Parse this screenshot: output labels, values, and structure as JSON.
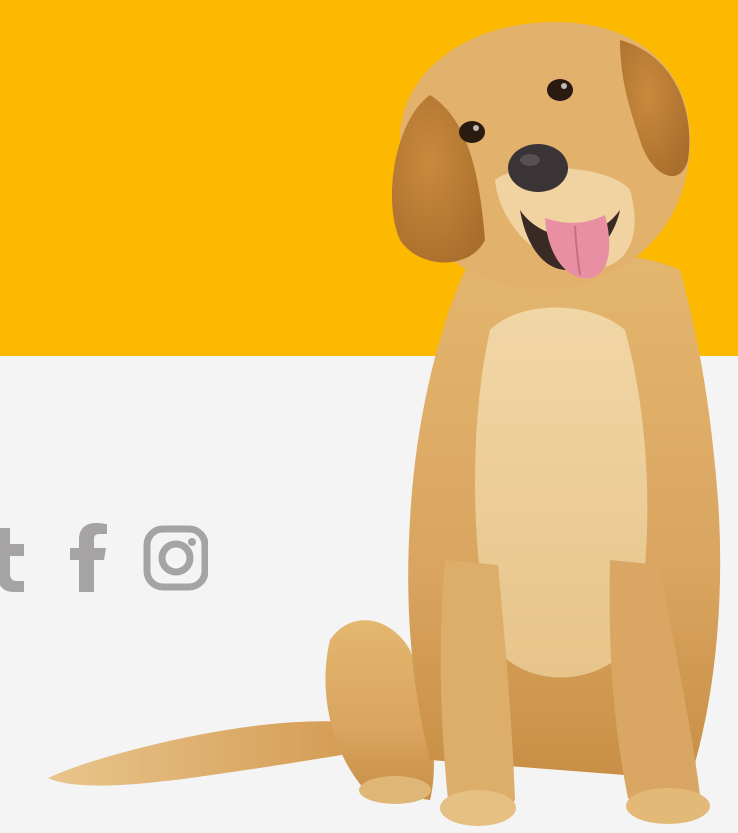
{
  "page": {
    "colors": {
      "accent_yellow": "#FDB800",
      "background_light": "#F4F4F5",
      "icon_gray": "#A5A3A4",
      "dog_gold": "#D9A560"
    }
  },
  "social": {
    "links": [
      {
        "network": "tumblr",
        "icon": "tumblr-icon"
      },
      {
        "network": "facebook",
        "icon": "facebook-icon"
      },
      {
        "network": "instagram",
        "icon": "instagram-icon"
      }
    ]
  },
  "hero_image": {
    "subject": "golden-retriever-sitting"
  }
}
